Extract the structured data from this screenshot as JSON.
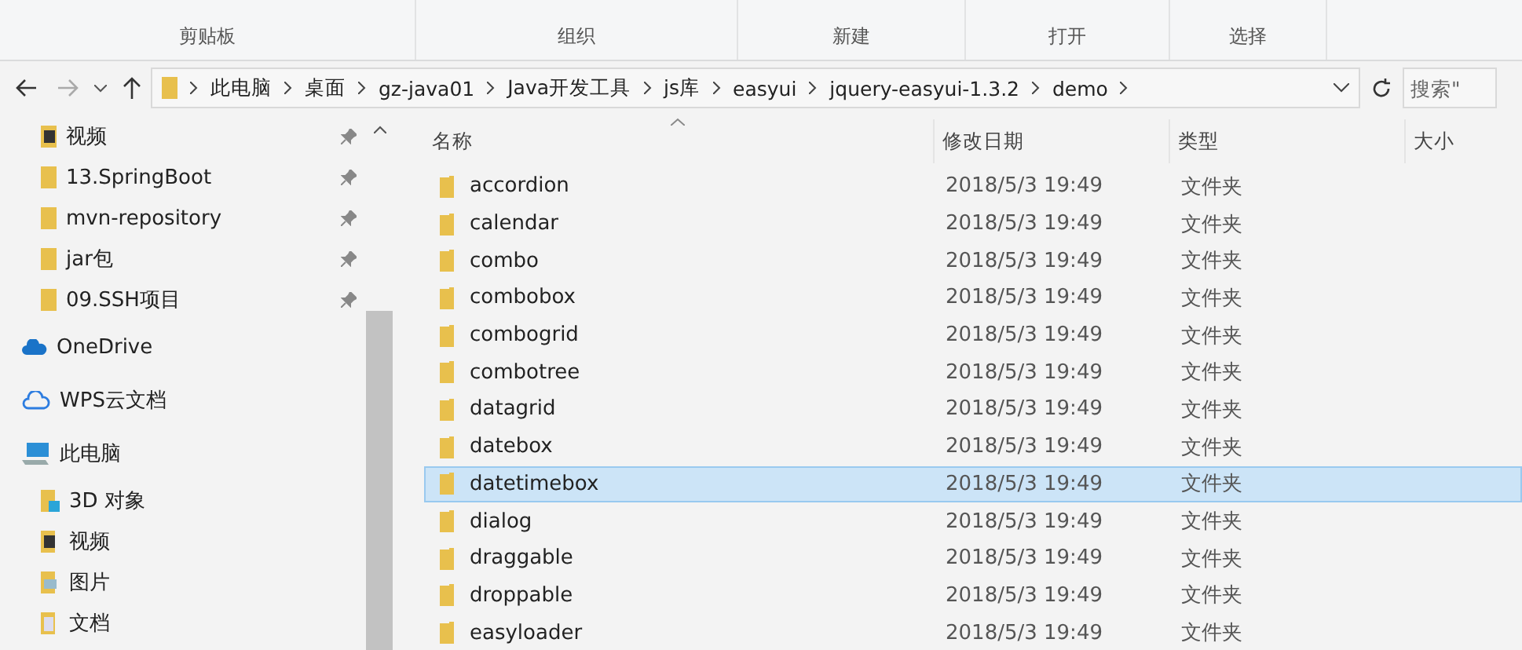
{
  "ribbon": {
    "groups": [
      "剪贴板",
      "组织",
      "新建",
      "打开",
      "选择"
    ]
  },
  "address_bar": {
    "path": [
      "此电脑",
      "桌面",
      "gz-java01",
      "Java开发工具",
      "js库",
      "easyui",
      "jquery-easyui-1.3.2",
      "demo"
    ],
    "search_placeholder": "搜索\""
  },
  "sidebar": {
    "pinned": [
      {
        "label": "视频",
        "kind": "video"
      },
      {
        "label": "13.SpringBoot",
        "kind": "folder"
      },
      {
        "label": "mvn-repository",
        "kind": "folder"
      },
      {
        "label": "jar包",
        "kind": "folder"
      },
      {
        "label": "09.SSH项目",
        "kind": "folder"
      }
    ],
    "items": [
      {
        "label": "OneDrive",
        "kind": "onedrive"
      },
      {
        "label": "WPS云文档",
        "kind": "cloud"
      },
      {
        "label": "此电脑",
        "kind": "computer",
        "children": [
          {
            "label": "3D 对象",
            "kind": "cube"
          },
          {
            "label": "视频",
            "kind": "video"
          },
          {
            "label": "图片",
            "kind": "pictures"
          },
          {
            "label": "文档",
            "kind": "documents"
          }
        ]
      }
    ]
  },
  "table": {
    "columns": [
      "名称",
      "修改日期",
      "类型",
      "大小"
    ],
    "rows": [
      {
        "name": "accordion",
        "date": "2018/5/3 19:49",
        "type": "文件夹",
        "selected": false
      },
      {
        "name": "calendar",
        "date": "2018/5/3 19:49",
        "type": "文件夹",
        "selected": false
      },
      {
        "name": "combo",
        "date": "2018/5/3 19:49",
        "type": "文件夹",
        "selected": false
      },
      {
        "name": "combobox",
        "date": "2018/5/3 19:49",
        "type": "文件夹",
        "selected": false
      },
      {
        "name": "combogrid",
        "date": "2018/5/3 19:49",
        "type": "文件夹",
        "selected": false
      },
      {
        "name": "combotree",
        "date": "2018/5/3 19:49",
        "type": "文件夹",
        "selected": false
      },
      {
        "name": "datagrid",
        "date": "2018/5/3 19:49",
        "type": "文件夹",
        "selected": false
      },
      {
        "name": "datebox",
        "date": "2018/5/3 19:49",
        "type": "文件夹",
        "selected": false
      },
      {
        "name": "datetimebox",
        "date": "2018/5/3 19:49",
        "type": "文件夹",
        "selected": true
      },
      {
        "name": "dialog",
        "date": "2018/5/3 19:49",
        "type": "文件夹",
        "selected": false
      },
      {
        "name": "draggable",
        "date": "2018/5/3 19:49",
        "type": "文件夹",
        "selected": false
      },
      {
        "name": "droppable",
        "date": "2018/5/3 19:49",
        "type": "文件夹",
        "selected": false
      },
      {
        "name": "easyloader",
        "date": "2018/5/3 19:49",
        "type": "文件夹",
        "selected": false
      }
    ]
  }
}
